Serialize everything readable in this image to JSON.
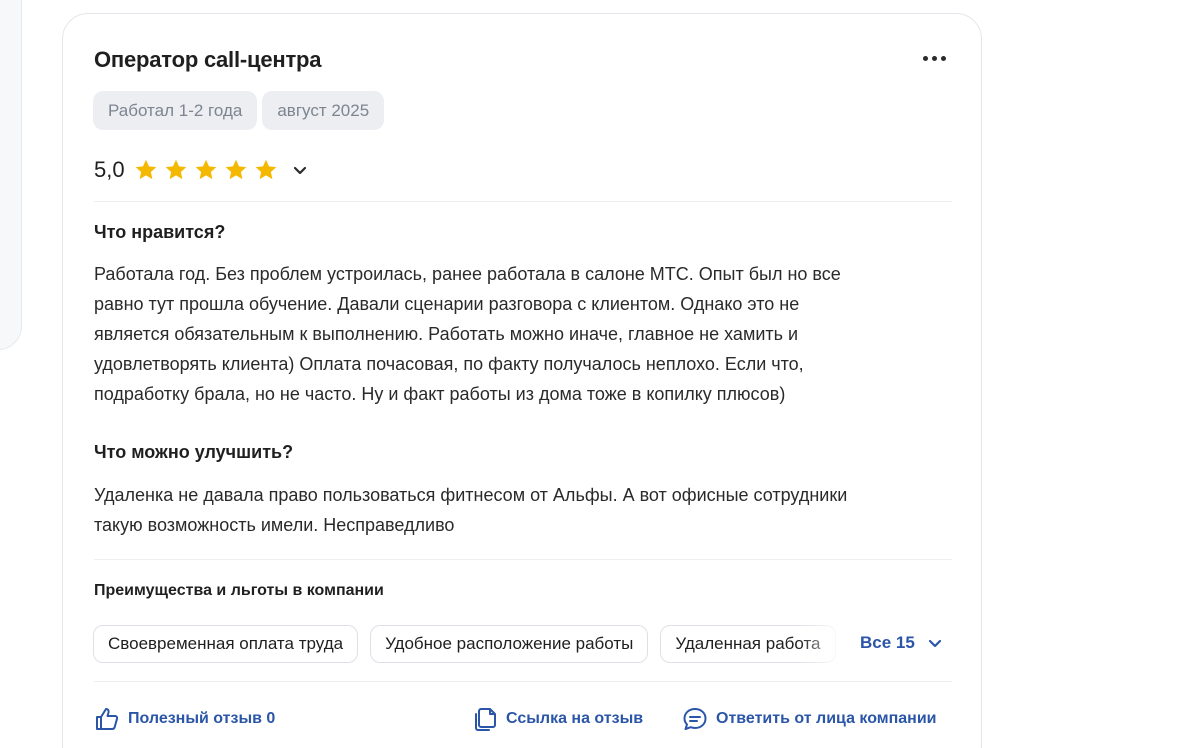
{
  "review": {
    "position": "Оператор call-центра",
    "tags": [
      "Работал 1-2 года",
      "август 2025"
    ],
    "rating": {
      "value_label": "5,0",
      "stars": 5,
      "max": 5,
      "star_color": "#f5b800"
    },
    "pros": {
      "heading": "Что нравится?",
      "lines": [
        "Работала год. Без проблем устроилась, ранее работала в салоне МТС. Опыт был но все",
        "равно тут прошла обучение. Давали сценарии разговора с клиентом. Однако это не",
        "является обязательным к выполнению. Работать можно иначе, главное не хамить и",
        "удовлетворять клиента) Оплата почасовая, по факту получалось неплохо. Если что,",
        "подработку брала, но не часто. Ну и факт работы из дома тоже в копилку плюсов)"
      ]
    },
    "cons": {
      "heading": "Что можно улучшить?",
      "lines": [
        "Удаленка не давала право пользоваться фитнесом от Альфы. А вот офисные сотрудники",
        "такую возможность имели. Несправедливо"
      ]
    },
    "benefits": {
      "heading": "Преимущества и льготы в компании",
      "items": [
        "Своевременная оплата труда",
        "Удобное расположение работы",
        "Удаленная работа"
      ],
      "all_label": "Все 15"
    },
    "actions": {
      "useful": "Полезный отзыв 0",
      "link": "Ссылка на отзыв",
      "reply": "Ответить от лица компании"
    },
    "colors": {
      "accent": "#2b56a8",
      "chip_bg": "#eceef2",
      "chip_text": "#7d8590"
    }
  }
}
